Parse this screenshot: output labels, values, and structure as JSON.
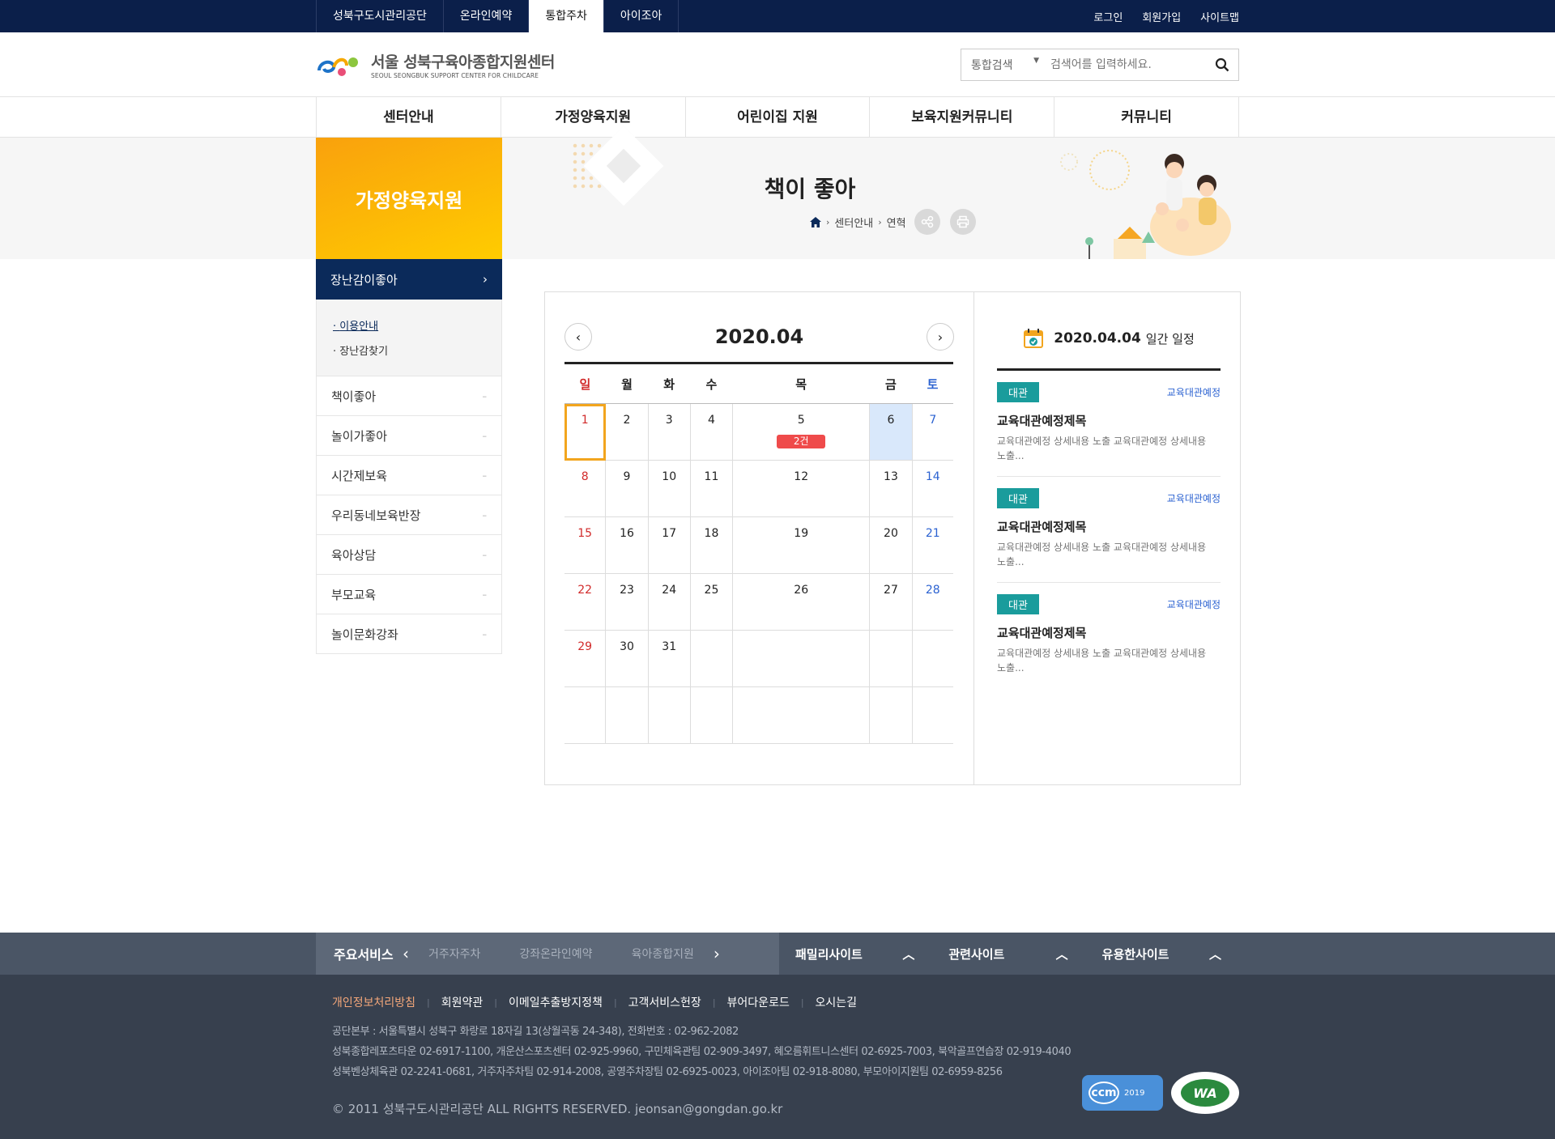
{
  "topbar": {
    "tabs": [
      "성북구도시관리공단",
      "온라인예약",
      "통합주차",
      "아이조아"
    ],
    "active_index": 2,
    "links": [
      "로그인",
      "회원가입",
      "사이트맵"
    ]
  },
  "header": {
    "logo_ko": "서울 성북구육아종합지원센터",
    "logo_en": "SEOUL SEONGBUK SUPPORT CENTER FOR CHILDCARE",
    "search_select": "통합검색",
    "search_placeholder": "검색어를 입력하세요."
  },
  "gnb": [
    "센터안내",
    "가정양육지원",
    "어린이집 지원",
    "보육지원커뮤니티",
    "커뮤니티"
  ],
  "visual": {
    "section_title": "가정양육지원",
    "page_title": "책이 좋아",
    "breadcrumb": [
      "센터안내",
      "연혁"
    ]
  },
  "side": {
    "active": "장난감이좋아",
    "sub": [
      "이용안내",
      "장난감찾기"
    ],
    "items": [
      "책이좋아",
      "놀이가좋아",
      "시간제보육",
      "우리동네보육반장",
      "육아상담",
      "부모교육",
      "놀이문화강좌"
    ]
  },
  "calendar": {
    "month": "2020.04",
    "weekdays": [
      "일",
      "월",
      "화",
      "수",
      "목",
      "금",
      "토"
    ],
    "weeks": [
      [
        "1",
        "2",
        "3",
        "4",
        "5",
        "6",
        "7"
      ],
      [
        "8",
        "9",
        "10",
        "11",
        "12",
        "13",
        "14"
      ],
      [
        "15",
        "16",
        "17",
        "18",
        "19",
        "20",
        "21"
      ],
      [
        "22",
        "23",
        "24",
        "25",
        "26",
        "27",
        "28"
      ],
      [
        "29",
        "30",
        "31",
        "",
        "",
        "",
        ""
      ],
      [
        "",
        "",
        "",
        "",
        "",
        "",
        ""
      ]
    ],
    "event_label": "2건"
  },
  "daily": {
    "date": "2020.04.04",
    "suffix": "일간 일정",
    "items": [
      {
        "badge": "대관",
        "category": "교육대관예정",
        "title": "교육대관예정제목",
        "desc": "교육대관예정 상세내용 노출 교육대관예정 상세내용 노출..."
      },
      {
        "badge": "대관",
        "category": "교육대관예정",
        "title": "교육대관예정제목",
        "desc": "교육대관예정 상세내용 노출 교육대관예정 상세내용 노출..."
      },
      {
        "badge": "대관",
        "category": "교육대관예정",
        "title": "교육대관예정제목",
        "desc": "교육대관예정 상세내용 노출 교육대관예정 상세내용 노출..."
      }
    ]
  },
  "footer": {
    "main_services_title": "주요서비스",
    "services": [
      "거주자주차",
      "강좌온라인예약",
      "육아종합지원"
    ],
    "sites": [
      "패밀리사이트",
      "관련사이트",
      "유용한사이트"
    ],
    "links": [
      "개인정보처리방침",
      "회원약관",
      "이메일추출방지정책",
      "고객서비스헌장",
      "뷰어다운로드",
      "오시는길"
    ],
    "address": [
      "공단본부 : 서울특별시 성북구 화랑로 18자길 13(상월곡동 24-348), 전화번호 : 02-962-2082",
      "성북종합레포츠타운 02-6917-1100, 개운산스포츠센터 02-925-9960, 구민체육관팀 02-909-3497, 혜오름휘트니스센터 02-6925-7003, 북악골프연습장 02-919-4040",
      "성북벤상체육관 02-2241-0681, 거주자주차팀 02-914-2008, 공영주차장팀 02-6925-0023, 아이조아팀 02-918-8080, 부모아이지원팀 02-6959-8256"
    ],
    "copyright": "© 2011 성북구도시관리공단 ALL RIGHTS RESERVED. jeonsan@gongdan.go.kr",
    "badge_ccm_text": "ccm",
    "badge_ccm_year": "2019",
    "badge_wa_text": "WA"
  }
}
